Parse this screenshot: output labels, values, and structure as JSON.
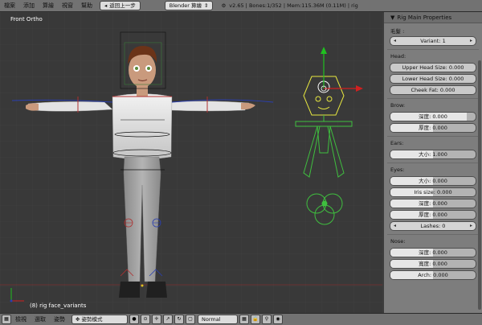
{
  "topbar": {
    "menus": [
      "檔案",
      "添加",
      "算繪",
      "視窗",
      "幫助"
    ],
    "back_button": "返回上一步",
    "engine": "Blender 算繪",
    "info": "v2.65 | Bones:1/352 | Mem:115.36M (0.11M) | rig"
  },
  "viewport": {
    "view_label": "Front Ortho",
    "status": "(8) rig face_variants"
  },
  "panel": {
    "title": "Rig Main Properties",
    "hair_label": "毛髮 :",
    "variant": "Variant: 1",
    "head_label": "Head:",
    "upper_head": "Upper Head Size: 0.000",
    "lower_head": "Lower Head Size: 0.000",
    "cheek_fat": "Cheek Fat: 0.000",
    "brow_label": "Brow:",
    "brow_depth": "深度: 0.000",
    "brow_thickness": "厚度: 0.000",
    "ears_label": "Ears:",
    "ears_size": "大小: 1.000",
    "eyes_label": "Eyes:",
    "eyes_size": "大小: 0.000",
    "iris_size": "Iris size: 0.000",
    "eyes_depth": "深度: 0.000",
    "eyes_thickness": "厚度: 0.000",
    "lashes": "Lashes: 0",
    "nose_label": "Nose:",
    "nose_depth": "深度: 0.000",
    "nose_width": "寬度: 0.000",
    "arch": "Arch: 0.000"
  },
  "bottombar": {
    "menus": [
      "檢視",
      "選取",
      "姿勢"
    ],
    "mode": "姿勢模式",
    "shading": "Normal"
  }
}
